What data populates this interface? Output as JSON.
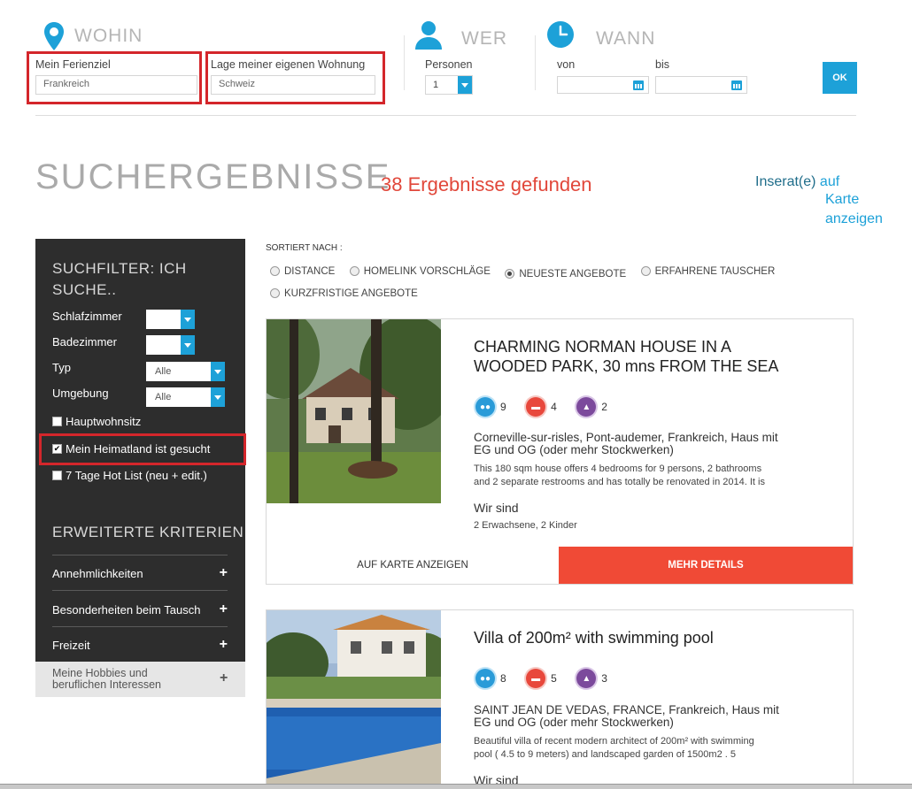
{
  "search": {
    "where": {
      "title": "WOHIN",
      "destination_label": "Mein Ferienziel",
      "destination_value": "Frankreich",
      "home_label": "Lage meiner eigenen Wohnung",
      "home_value": "Schweiz"
    },
    "who": {
      "title": "WER",
      "persons_label": "Personen",
      "persons_value": "1"
    },
    "when": {
      "title": "WANN",
      "from_label": "von",
      "to_label": "bis",
      "from_value": "",
      "to_value": ""
    },
    "ok_label": "OK"
  },
  "results": {
    "title": "SUCHERGEBNISSE",
    "count_text": "38 Ergebnisse gefunden",
    "map_link_part1": "Inserat(e)",
    "map_link_part2": "auf",
    "map_link_part3": "Karte",
    "map_link_part4": "anzeigen"
  },
  "sidebar": {
    "title_line1": "SUCHFILTER: ICH",
    "title_line2": "SUCHE..",
    "bedrooms_label": "Schlafzimmer",
    "bedrooms_value": "",
    "bathrooms_label": "Badezimmer",
    "bathrooms_value": "",
    "type_label": "Typ",
    "type_value": "Alle",
    "surroundings_label": "Umgebung",
    "surroundings_value": "Alle",
    "checks": [
      {
        "label": "Hauptwohnsitz",
        "checked": false
      },
      {
        "label": "Mein Heimatland ist gesucht",
        "checked": true
      },
      {
        "label": "7 Tage Hot List (neu + edit.)",
        "checked": false
      }
    ],
    "extended_title": "ERWEITERTE KRITERIEN",
    "accordion": [
      "Annehmlichkeiten",
      "Besonderheiten beim Tausch",
      "Freizeit",
      "Meine Hobbies und beruflichen Interessen"
    ]
  },
  "sort": {
    "label": "SORTIERT NACH :",
    "options": [
      {
        "label": "DISTANCE",
        "selected": false
      },
      {
        "label": "HOMELINK VORSCHLÄGE",
        "selected": false
      },
      {
        "label": "NEUESTE ANGEBOTE",
        "selected": true
      },
      {
        "label": "ERFAHRENE TAUSCHER",
        "selected": false
      },
      {
        "label": "KURZFRISTIGE ANGEBOTE",
        "selected": false
      }
    ]
  },
  "listings": [
    {
      "title_line1": "CHARMING NORMAN HOUSE IN A",
      "title_line2": "WOODED PARK, 30 mns FROM THE SEA",
      "persons": "9",
      "bedrooms": "4",
      "bathrooms": "2",
      "location_line1": "Corneville-sur-risles, Pont-audemer, Frankreich, Haus mit",
      "location_line2": "EG und OG (oder mehr Stockwerken)",
      "desc_line1": "This 180 sqm house offers 4 bedrooms for 9 persons, 2 bathrooms",
      "desc_line2": "and 2 separate restrooms and has totally be renovated in 2014. It is",
      "we_are": "Wir sind",
      "family": "2 Erwachsene, 2 Kinder",
      "map_button": "AUF KARTE ANZEIGEN",
      "details_button": "MEHR DETAILS"
    },
    {
      "title_line1": "Villa of 200m² with swimming pool",
      "persons": "8",
      "bedrooms": "5",
      "bathrooms": "3",
      "location_line1": "SAINT JEAN DE VEDAS, FRANCE, Frankreich, Haus mit",
      "location_line2": "EG und OG (oder mehr Stockwerken)",
      "desc_line1": "Beautiful villa of recent modern architect of 200m² with swimming",
      "desc_line2": "pool ( 4.5 to 9 meters) and landscaped garden of 1500m2 . 5",
      "we_are": "Wir sind"
    }
  ],
  "colors": {
    "accent_blue": "#1da1d8",
    "accent_red": "#f04a36",
    "count_red": "#e1473a",
    "highlight_box": "#d4262b",
    "sidebar_bg": "#2d2d2d"
  },
  "icons": {
    "where": "map-pin-icon",
    "who": "user-icon",
    "when": "clock-icon",
    "date": "calendar-icon",
    "persons": "people-icon",
    "bedrooms": "bed-icon",
    "bathrooms": "bath-icon",
    "accordion": "plus-icon"
  }
}
